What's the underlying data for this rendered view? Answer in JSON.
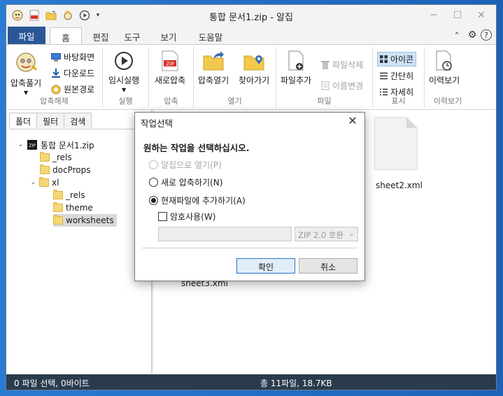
{
  "window": {
    "title": "통합 문서1.zip - 알집",
    "controls": [
      "─",
      "☐",
      "✕"
    ]
  },
  "ribbon_tabs": [
    "파일",
    "홈",
    "편집",
    "도구",
    "보기",
    "도움말"
  ],
  "ribbon_right": {
    "collapse": "⌃",
    "settings": "⚙",
    "help": "?"
  },
  "ribbon": {
    "extract_group": {
      "label": "압축해제",
      "big": "압축풀기",
      "desktop": "바탕화면",
      "downloads": "다운로드",
      "original": "원본경로"
    },
    "run_group": {
      "label": "실행",
      "big": "임시실행"
    },
    "compress_group": {
      "label": "압축",
      "big": "새로압축"
    },
    "open_group": {
      "label": "열기",
      "open": "압축열기",
      "find": "찾아가기"
    },
    "file_group": {
      "label": "파일",
      "add": "파일추가",
      "delete": "파일삭제",
      "rename": "이름변경"
    },
    "view_group": {
      "label": "표시",
      "icons": "아이콘",
      "simple": "간단히",
      "detail": "자세히"
    },
    "history_group": {
      "label": "이력보기",
      "big": "이력보기"
    }
  },
  "panel_tabs": [
    "폴더",
    "필터",
    "검색"
  ],
  "tree": {
    "root": "통합 문서1.zip",
    "rels": "_rels",
    "docprops": "docProps",
    "xl": "xl",
    "xl_rels": "_rels",
    "theme": "theme",
    "worksheets": "worksheets"
  },
  "files": {
    "sheet2": "sheet2.xml",
    "sheet3": "sheet3.xml"
  },
  "status": {
    "left": "0 파일 선택, 0바이트",
    "right": "총 11파일, 18.7KB"
  },
  "dialog": {
    "title": "작업선택",
    "prompt": "원하는 작업을 선택하십시오.",
    "opt_open": "알집으로 열기(P)",
    "opt_new": "새로 압축하기(N)",
    "opt_add": "현재파일에 추가하기(A)",
    "password": "암호사용(W)",
    "zip_version": "ZIP 2.0 호환",
    "ok": "확인",
    "cancel": "취소"
  }
}
